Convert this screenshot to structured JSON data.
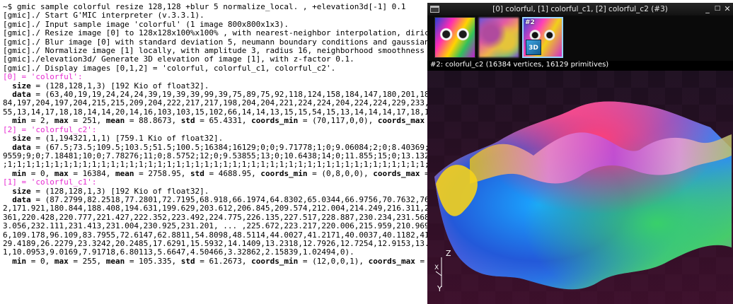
{
  "terminal": {
    "lines": [
      [
        {
          "t": "~$ gmic sample colorful resize 128,128 +blur 5 normalize_local. , +elevation3d[-1] 0.1"
        }
      ],
      [
        {
          "t": "[gmic]./ Start G'MIC interpreter (v.3.3.1)."
        }
      ],
      [
        {
          "t": "[gmic]./ Input sample image 'colorful' (1 image 800x800x1x3)."
        }
      ],
      [
        {
          "t": "[gmic]./ Resize image [0] to 128x128x100%x100% , with nearest-neighbor interpolation, dirichlet boundary conditions and alignment (0,0,0,0)."
        }
      ],
      [
        {
          "t": "[gmic]./ Blur image [0] with standard deviation 5, neumann boundary conditions and gaussian kernel."
        }
      ],
      [
        {
          "t": "[gmic]./ Normalize image [1] locally, with amplitude 3, radius 16, neighborhood smoothness 4 and average smoothness 2."
        }
      ],
      [
        {
          "t": "[gmic]./elevation3d/ Generate 3D elevation of image [1], with z-factor 0.1."
        }
      ],
      [
        {
          "t": "[gmic]./ Display images [0,1,2] = 'colorful, colorful_c1, colorful_c2'."
        }
      ],
      [
        {
          "t": "[0] = 'colorful':",
          "c": "pink"
        }
      ],
      [
        {
          "t": "  size",
          "c": "b"
        },
        {
          "t": " = (128,128,1,3) [192 Kio of float32]."
        }
      ],
      [
        {
          "t": "  data",
          "c": "b"
        },
        {
          "t": " = (63,40,19,19,24,24,24,39,19,39,39,99,39,75,89,75,92,118,124,158,184,147,180,201,183,201,190,187,180,201,205"
        }
      ],
      [
        {
          "t": "84,197,204,197,204,215,215,209,204,222,217,217,198,204,204,221,224,224,204,224,224,229,233,234,229,230,233,230"
        }
      ],
      [
        {
          "t": "55,13,14,17,18,18,14,14,20,14,16,103,103,15,102,66,14,14,13,15,15,54,15,13,14,14,14,17,18,14,14,13,16,18"
        }
      ],
      [
        {
          "t": "  min",
          "c": "b"
        },
        {
          "t": " = 2, "
        },
        {
          "t": "max",
          "c": "b"
        },
        {
          "t": " = 251, "
        },
        {
          "t": "mean",
          "c": "b"
        },
        {
          "t": " = 88.8673, "
        },
        {
          "t": "std",
          "c": "b"
        },
        {
          "t": " = 65.4331, "
        },
        {
          "t": "coords_min",
          "c": "b"
        },
        {
          "t": " = (70,117,0,0), "
        },
        {
          "t": "coords_max",
          "c": "b"
        },
        {
          "t": " = (6,"
        }
      ],
      [
        {
          "t": "[2] = 'colorful_c2':",
          "c": "pink"
        }
      ],
      [
        {
          "t": "  size",
          "c": "b"
        },
        {
          "t": " = (1,194321,1,1) [759.1 Kio of float32]."
        }
      ],
      [
        {
          "t": "  data",
          "c": "b"
        },
        {
          "t": " = (67.5;73.5;109.5;103.5;51.5;100.5;16384;16129;0;0;9.71778;1;0;9.06084;2;0;8.40369;3;0;7.76"
        }
      ],
      [
        {
          "t": "9559;9;0;7.18481;10;0;7.78276;11;0;8.5752;12;0;9.53855;13;0;10.6438;14;0;11.855;15;0;13.1328;16;0;14.4484;17"
        }
      ],
      [
        {
          "t": ";1;1;1;1;1;1;1;1;1;1;1;1;1;1;1;1;1;1;1;1;1;1;1;1;1;1;1;1;1;1;1;1;1;1;1;1;1;1;1;1;1;1;1;1;1;1;1;1;1;1;1;1;1;1;1"
        }
      ],
      [
        {
          "t": "  min",
          "c": "b"
        },
        {
          "t": " = 0, "
        },
        {
          "t": "max",
          "c": "b"
        },
        {
          "t": " = 16384, "
        },
        {
          "t": "mean",
          "c": "b"
        },
        {
          "t": " = 2758.95, "
        },
        {
          "t": "std",
          "c": "b"
        },
        {
          "t": " = 4688.95, "
        },
        {
          "t": "coords_min",
          "c": "b"
        },
        {
          "t": " = (0,8,0,0), "
        },
        {
          "t": "coords_max",
          "c": "b"
        },
        {
          "t": " = (0,6"
        }
      ],
      [
        {
          "t": "[1] = 'colorful_c1':",
          "c": "pink"
        }
      ],
      [
        {
          "t": "  size",
          "c": "b"
        },
        {
          "t": " = (128,128,1,3) [192 Kio of float32]."
        }
      ],
      [
        {
          "t": "  data",
          "c": "b"
        },
        {
          "t": " = (87.2799,82.2518,77.2801,72.7195,68.918,66.1974,64.8302,65.0344,66.9756,70.7632,76.2837,83.0"
        }
      ],
      [
        {
          "t": "2,171.921,180.844,188.408,194.631,199.629,203.612,206.845,209.574,212.004,214.249,216.311,218.098,219.468,220"
        }
      ],
      [
        {
          "t": "361,220.428,220.777,221.427,222.352,223.492,224.775,226.135,227.517,228.887,230.234,231.568,232.894,234.195,23"
        }
      ],
      [
        {
          "t": "3.056,232.111,231.413,231.004,230.925,231.201, ... ,225.672,223.217,220.006,215.959,210.969,204.957,197.904"
        }
      ],
      [
        {
          "t": "6,109.178,96.109,83.7955,72.6147,62.8811,54.8098,48.5114,44.0027,41.2171,40.0037,40.1182,41.2944,43.1532,45"
        }
      ],
      [
        {
          "t": "29.4189,26.2279,23.3242,20.2485,17.6291,15.5932,14.1409,13.2318,12.7926,12.7254,12.9153,13.2335,13.5579,13"
        }
      ],
      [
        {
          "t": "1,10.0953,9.0169,7.91718,6.80113,5.6647,4.50466,3.32862,2.15839,1.02494,0)."
        }
      ],
      [
        {
          "t": "  min",
          "c": "b"
        },
        {
          "t": " = 0, "
        },
        {
          "t": "max",
          "c": "b"
        },
        {
          "t": " = 255, "
        },
        {
          "t": "mean",
          "c": "b"
        },
        {
          "t": " = 105.335, "
        },
        {
          "t": "std",
          "c": "b"
        },
        {
          "t": " = 61.2673, "
        },
        {
          "t": "coords_min",
          "c": "b"
        },
        {
          "t": " = (12,0,0,1), "
        },
        {
          "t": "coords_max",
          "c": "b"
        },
        {
          "t": " = (1"
        }
      ]
    ]
  },
  "viewer": {
    "title": "[0] colorful, [1] colorful_c1, [2] colorful_c2 (#3)",
    "thumb_selected_label": "#2",
    "thumb_3d_label": "3D",
    "status": "#2:  colorful_c2 (16384 vertices, 16129 primitives)",
    "axis_z": "Z",
    "axis_x": "X",
    "axis_y": "Y",
    "btn_minimize": "_",
    "btn_maximize": "□",
    "btn_close": "✕"
  },
  "colors": {
    "label_pink": "#e62ad1",
    "titlebar": "#1c1c1c",
    "background": "#ffffff"
  }
}
